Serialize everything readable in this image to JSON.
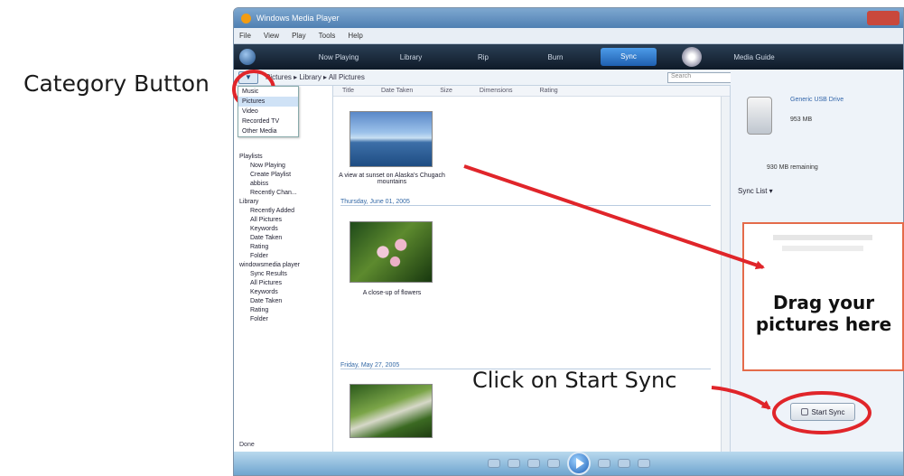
{
  "annotations": {
    "category_button": "Category Button",
    "drag_pictures": "Drag your pictures here",
    "click_start_sync": "Click on Start Sync"
  },
  "window": {
    "title": "Windows Media Player"
  },
  "menu": [
    "File",
    "View",
    "Play",
    "Tools",
    "Help"
  ],
  "tabs": [
    "Now Playing",
    "Library",
    "Rip",
    "Burn",
    "Sync",
    "Media Guide"
  ],
  "active_tab": "Sync",
  "breadcrumb": "Pictures ▸ Library ▸ All Pictures",
  "search_placeholder": "Search",
  "category_menu": [
    "Music",
    "Pictures",
    "Video",
    "Recorded TV",
    "Other Media"
  ],
  "category_menu_selected": "Pictures",
  "nav_tree": [
    {
      "label": "Playlists",
      "indent": 0
    },
    {
      "label": "Now Playing",
      "indent": 1
    },
    {
      "label": "Create Playlist",
      "indent": 1
    },
    {
      "label": "abbiss",
      "indent": 1
    },
    {
      "label": "Recently Chan...",
      "indent": 1
    },
    {
      "label": "Library",
      "indent": 0
    },
    {
      "label": "Recently Added",
      "indent": 1
    },
    {
      "label": "All Pictures",
      "indent": 1
    },
    {
      "label": "Keywords",
      "indent": 1
    },
    {
      "label": "Date Taken",
      "indent": 1
    },
    {
      "label": "Rating",
      "indent": 1
    },
    {
      "label": "Folder",
      "indent": 1
    },
    {
      "label": "windowsmedia player",
      "indent": 0
    },
    {
      "label": "Sync Results",
      "indent": 1
    },
    {
      "label": "All Pictures",
      "indent": 1
    },
    {
      "label": "Keywords",
      "indent": 1
    },
    {
      "label": "Date Taken",
      "indent": 1
    },
    {
      "label": "Rating",
      "indent": 1
    },
    {
      "label": "Folder",
      "indent": 1
    }
  ],
  "columns": [
    "Title",
    "Date Taken",
    "Size",
    "Dimensions",
    "Rating"
  ],
  "pictures": [
    {
      "caption": "A view at sunset on Alaska's Chugach mountains"
    },
    {
      "caption": "A close-up of flowers"
    },
    {
      "caption": ""
    }
  ],
  "groups": [
    "Thursday, June 01, 2005",
    "Friday, May 27, 2005"
  ],
  "device": {
    "name": "Generic USB Drive",
    "capacity": "953 MB",
    "remaining": "930 MB remaining"
  },
  "sync_list_label": "Sync List ▾",
  "start_sync_label": "Start Sync",
  "status": "Done",
  "colors": {
    "annotation_red": "#e0252a",
    "drop_box_border": "#e46b4a",
    "arrow_red": "#e0252a"
  }
}
